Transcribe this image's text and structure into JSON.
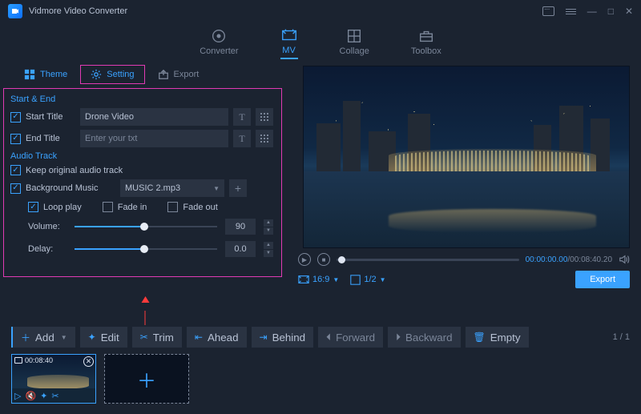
{
  "app": {
    "title": "Vidmore Video Converter"
  },
  "maintabs": {
    "converter": "Converter",
    "mv": "MV",
    "collage": "Collage",
    "toolbox": "Toolbox"
  },
  "subtabs": {
    "theme": "Theme",
    "setting": "Setting",
    "export": "Export"
  },
  "settings": {
    "section1_title": "Start & End",
    "start_title_label": "Start Title",
    "start_title_value": "Drone Video",
    "end_title_label": "End Title",
    "end_title_placeholder": "Enter your txt",
    "section2_title": "Audio Track",
    "keep_audio_label": "Keep original audio track",
    "bgm_label": "Background Music",
    "bgm_value": "MUSIC 2.mp3",
    "loop_label": "Loop play",
    "fadein_label": "Fade in",
    "fadeout_label": "Fade out",
    "volume_label": "Volume:",
    "volume_value": "90",
    "delay_label": "Delay:",
    "delay_value": "0.0"
  },
  "player": {
    "current": "00:00:00.00",
    "sep": "/",
    "total": "00:08:40.20",
    "aspect": "16:9",
    "zoom": "1/2",
    "export": "Export"
  },
  "toolbar": {
    "add": "Add",
    "edit": "Edit",
    "trim": "Trim",
    "ahead": "Ahead",
    "behind": "Behind",
    "forward": "Forward",
    "backward": "Backward",
    "empty": "Empty",
    "page_cur": "1",
    "page_sep": "/",
    "page_total": "1"
  },
  "thumb": {
    "duration": "00:08:40"
  }
}
